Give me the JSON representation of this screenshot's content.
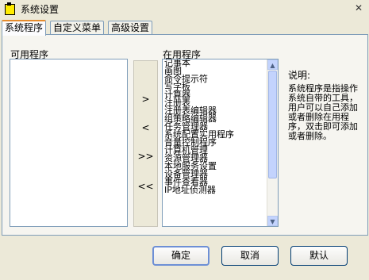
{
  "window": {
    "title": "系统设置",
    "close_symbol": "✕"
  },
  "tabs": [
    {
      "label": "系统程序",
      "active": true
    },
    {
      "label": "自定义菜单",
      "active": false
    },
    {
      "label": "高级设置",
      "active": false
    }
  ],
  "available": {
    "label": "可用程序",
    "items": []
  },
  "in_use": {
    "label": "在用程序",
    "items": [
      "记事本",
      "画图",
      "命令提示符",
      "写字板",
      "计算器",
      "注册表",
      "注册表编辑器",
      "组策略编辑器",
      "任务管理器",
      "系统配置实用程序",
      "音量控制程序",
      "计算机管理",
      "资源管理器",
      "本地服务设置",
      "设备管理器",
      "事件查看器",
      "IP地址侦测器"
    ]
  },
  "move_buttons": {
    "add": ">",
    "remove": "<",
    "add_all": ">>",
    "remove_all": "<<"
  },
  "description": {
    "title": "说明:",
    "body": "系统程序是指操作系统自带的工具，用户可以自己添加或者删除在用程序，双击即可添加或者删除。"
  },
  "buttons": {
    "ok": "确定",
    "cancel": "取消",
    "default": "默认"
  },
  "colors": {
    "active_tab_accent": "#e68b2c",
    "scroll_thumb": "#c3d3fd"
  }
}
